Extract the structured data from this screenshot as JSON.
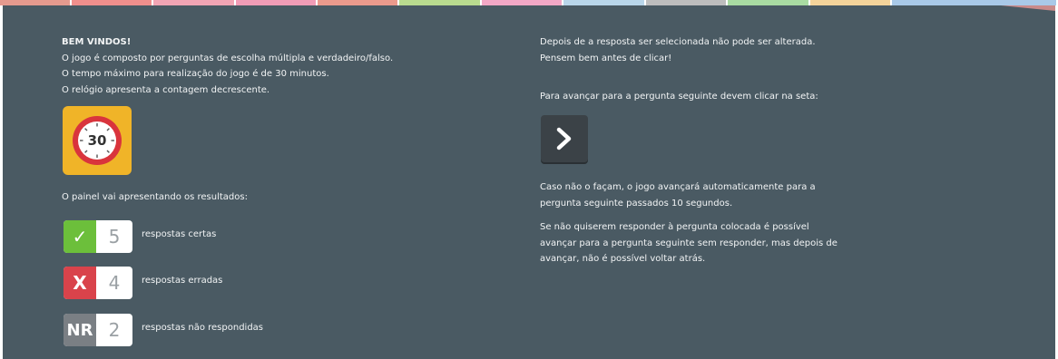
{
  "topbar": {
    "colors": [
      "#e59a8e",
      "#f08f8c",
      "#f2a5b4",
      "#f19cb6",
      "#eb9a8c",
      "#b9db8f",
      "#f3a8c6",
      "#b9d6ea",
      "#bdbdbd",
      "#a9dba2",
      "#f4d39a",
      "#a9c9e8"
    ]
  },
  "intro": {
    "title": "BEM VINDOS!",
    "line1": "O jogo é composto por perguntas de escolha múltipla e verdadeiro/falso.",
    "line2": "O tempo máximo para realização do jogo é de 30 minutos.",
    "line3": "O relógio apresenta a contagem decrescente."
  },
  "clock": {
    "value": "30",
    "icon": "stopwatch-icon"
  },
  "painel": {
    "label": "O painel vai apresentando os resultados:",
    "rows": [
      {
        "symbol": "✓",
        "color": "#6cbf3b",
        "count": "5",
        "label": "respostas certas"
      },
      {
        "symbol": "X",
        "color": "#d9434b",
        "count": "4",
        "label": "respostas erradas"
      },
      {
        "symbol": "NR",
        "color": "#7a7f84",
        "count": "2",
        "label": "respostas não respondidas"
      }
    ]
  },
  "right": {
    "line1": "Depois de a resposta ser selecionada não pode ser alterada.",
    "line2": "Pensem bem antes de clicar!",
    "advance": "Para avançar para a pergunta seguinte devem clicar na seta:",
    "caso1": "Caso não o façam, o jogo avançará automaticamente para a",
    "caso2": "pergunta seguinte passados 10 segundos.",
    "skip1": "Se não quiserem responder à pergunta colocada é possível",
    "skip2": "avançar para a pergunta seguinte sem responder, mas depois de",
    "skip3": "avançar, não é possível voltar atrás."
  }
}
